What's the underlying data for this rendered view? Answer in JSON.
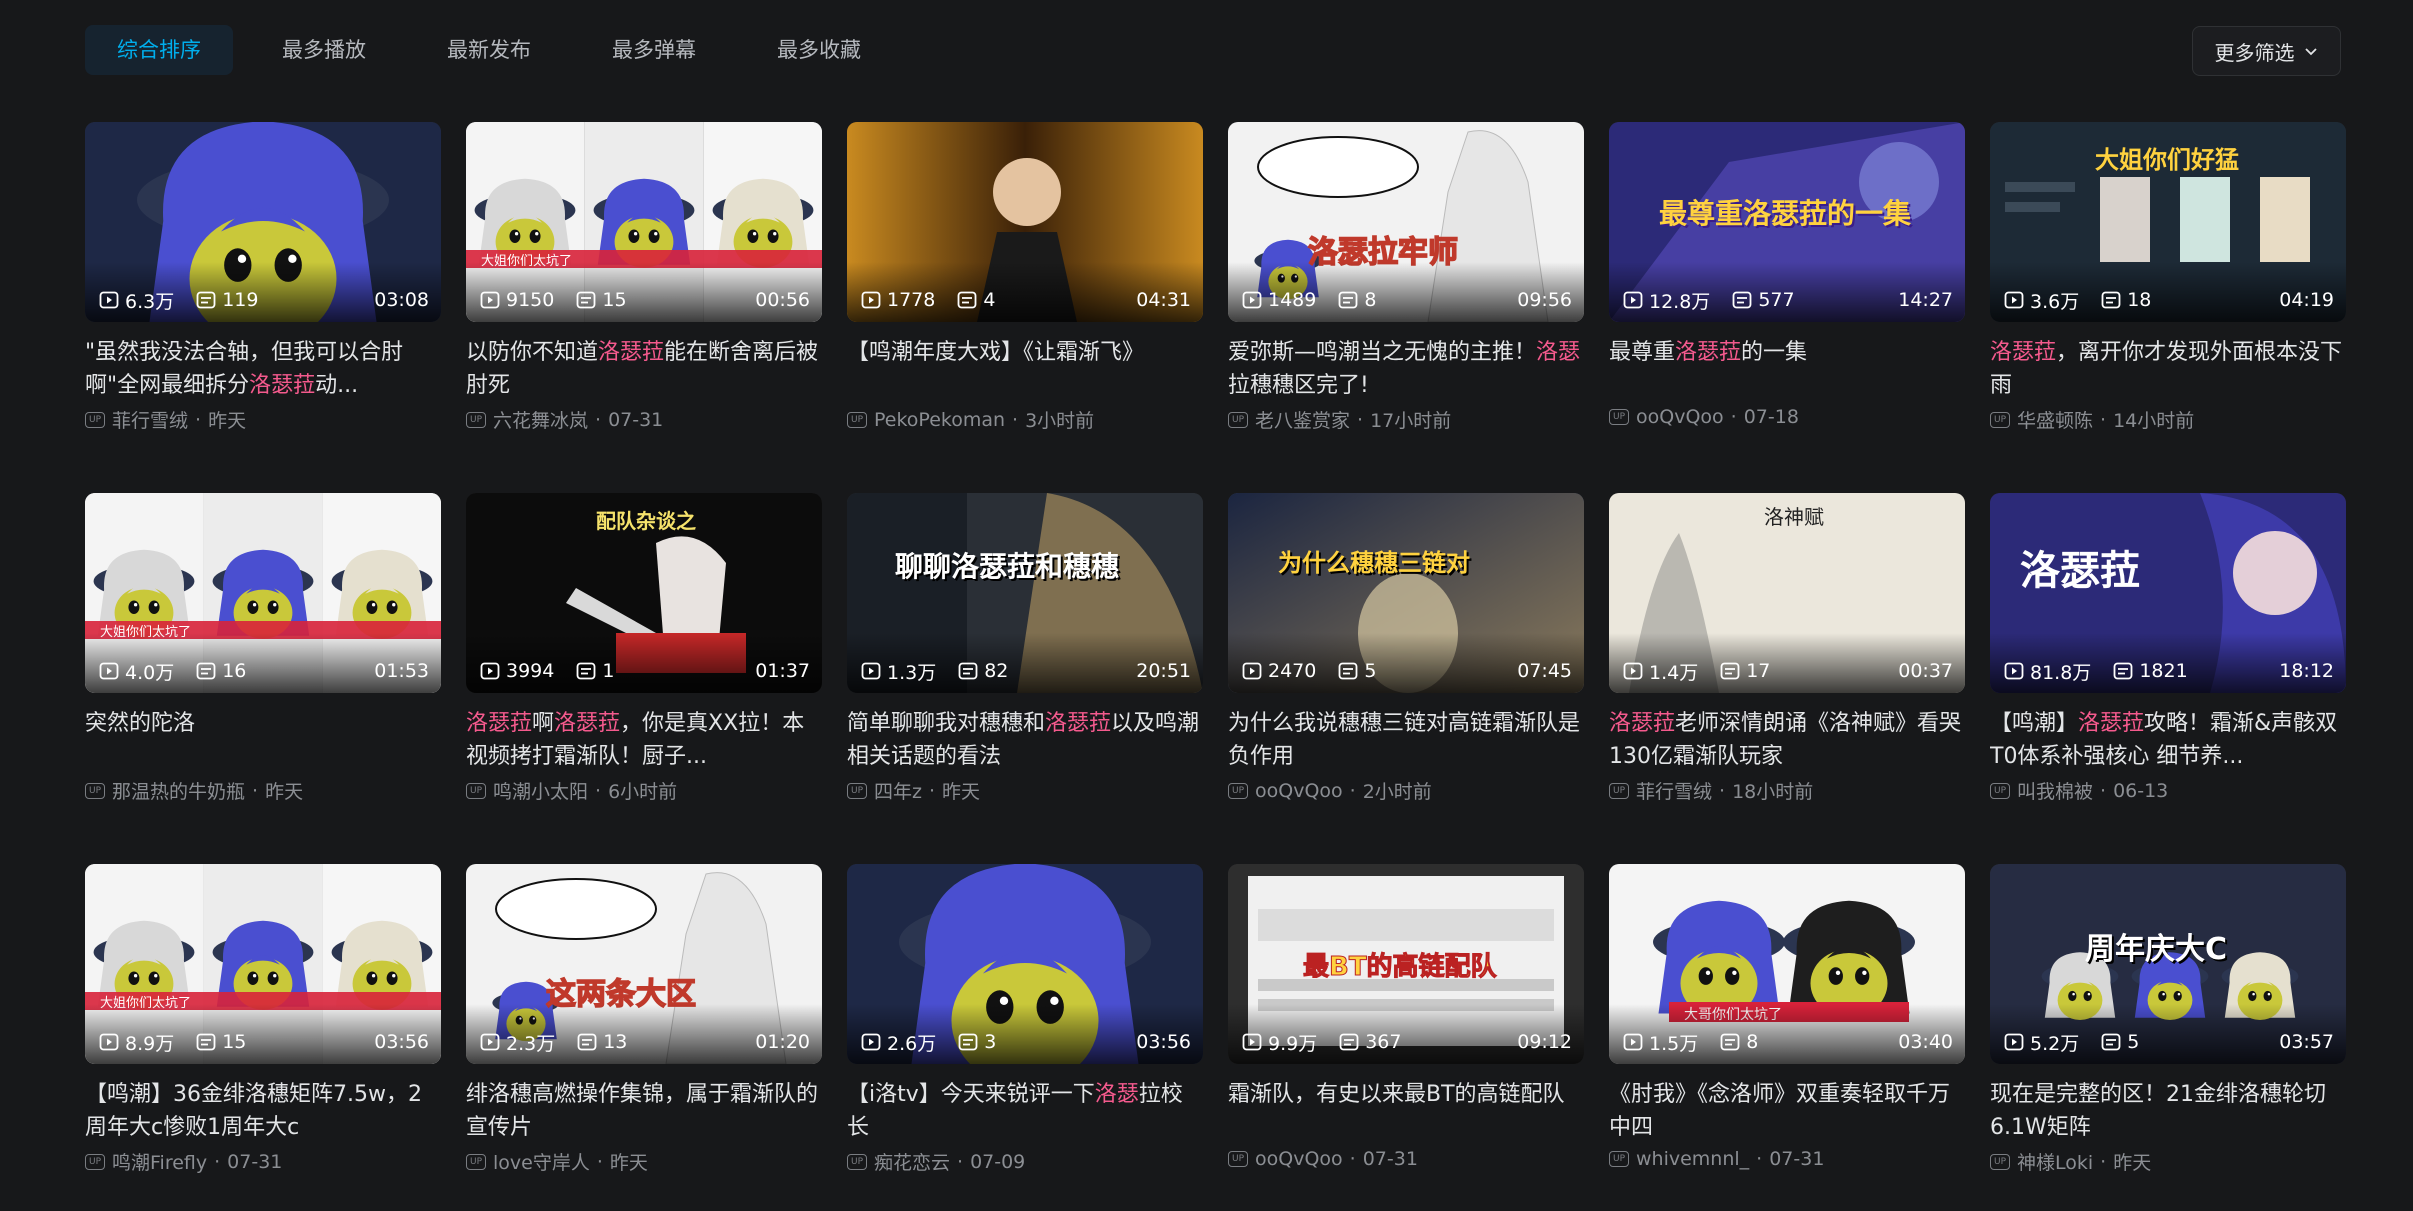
{
  "sort_tabs": [
    "综合排序",
    "最多播放",
    "最新发布",
    "最多弹幕",
    "最多收藏"
  ],
  "more_filter": "更多筛选",
  "colors": {
    "accent": "#00aeec",
    "highlight": "#f45a8d",
    "background": "#17181a"
  },
  "videos": [
    {
      "views": "6.3万",
      "danmaku": "119",
      "duration": "03:08",
      "title_parts": [
        {
          "t": "\"虽然我没法合轴，但我可以合肘啊\"全网最细拆分"
        },
        {
          "t": "洛瑟菈",
          "hl": true
        },
        {
          "t": "动..."
        }
      ],
      "author": "菲行雪绒",
      "date": "昨天",
      "art": "face",
      "bg": "#3a4f7a"
    },
    {
      "views": "9150",
      "danmaku": "15",
      "duration": "00:56",
      "title_parts": [
        {
          "t": "以防你不知道"
        },
        {
          "t": "洛瑟菈",
          "hl": true
        },
        {
          "t": "能在断舍离后被肘死"
        }
      ],
      "author": "六花舞冰岚",
      "date": "07-31",
      "art": "trio",
      "bg": "#dcdcdc",
      "caption": "大姐你们太坑了"
    },
    {
      "views": "1778",
      "danmaku": "4",
      "duration": "04:31",
      "title_parts": [
        {
          "t": "【鸣潮年度大戏】《让霜渐飞》"
        }
      ],
      "author": "PekoPekoman",
      "date": "3小时前",
      "art": "stage",
      "bg": "#7a4a16"
    },
    {
      "views": "1489",
      "danmaku": "8",
      "duration": "09:56",
      "title_parts": [
        {
          "t": "爱弥斯—鸣潮当之无愧的主推！"
        },
        {
          "t": "洛瑟",
          "hl": true
        },
        {
          "t": "拉穗穗区完了!"
        }
      ],
      "author": "老八鉴赏家",
      "date": "17小时前",
      "art": "comic",
      "bg": "#ededed",
      "caption": "洛瑟拉牢师"
    },
    {
      "views": "12.8万",
      "danmaku": "577",
      "duration": "14:27",
      "title_parts": [
        {
          "t": "最尊重"
        },
        {
          "t": "洛瑟菈",
          "hl": true
        },
        {
          "t": "的一集"
        }
      ],
      "author": "ooQvQoo",
      "date": "07-18",
      "art": "purple",
      "bg": "#3b3a8c",
      "caption": "最尊重洛瑟菈的一集"
    },
    {
      "views": "3.6万",
      "danmaku": "18",
      "duration": "04:19",
      "title_parts": [
        {
          "t": "洛瑟菈",
          "hl": true
        },
        {
          "t": "，离开你才发现外面根本没下雨"
        }
      ],
      "author": "华盛顿陈",
      "date": "14小时前",
      "art": "team",
      "bg": "#1f3040",
      "caption": "大姐你们好猛"
    },
    {
      "views": "4.0万",
      "danmaku": "16",
      "duration": "01:53",
      "title_parts": [
        {
          "t": "突然的陀洛"
        }
      ],
      "author": "那温热的牛奶瓶",
      "date": "昨天",
      "art": "trio",
      "bg": "#e8e8e8",
      "caption": "大姐你们太坑了"
    },
    {
      "views": "3994",
      "danmaku": "1",
      "duration": "01:37",
      "title_parts": [
        {
          "t": "洛瑟菈",
          "hl": true
        },
        {
          "t": "啊"
        },
        {
          "t": "洛瑟菈",
          "hl": true
        },
        {
          "t": "，你是真XX拉！本视频拷打霜渐队！厨子..."
        }
      ],
      "author": "鸣潮小太阳",
      "date": "6小时前",
      "art": "dark",
      "bg": "#101010",
      "caption": "配队杂谈之"
    },
    {
      "views": "1.3万",
      "danmaku": "82",
      "duration": "20:51",
      "title_parts": [
        {
          "t": "简单聊聊我对穗穗和"
        },
        {
          "t": "洛瑟菈",
          "hl": true
        },
        {
          "t": "以及鸣潮相关话题的看法"
        }
      ],
      "author": "四年z",
      "date": "昨天",
      "art": "talk",
      "bg": "#2a3038",
      "caption": "聊聊洛瑟菈和穗穗"
    },
    {
      "views": "2470",
      "danmaku": "5",
      "duration": "07:45",
      "title_parts": [
        {
          "t": "为什么我说穗穗三链对高链霜渐队是负作用"
        }
      ],
      "author": "ooQvQoo",
      "date": "2小时前",
      "art": "game",
      "bg": "#2c3a55",
      "caption": "为什么穗穗三链对"
    },
    {
      "views": "1.4万",
      "danmaku": "17",
      "duration": "00:37",
      "title_parts": [
        {
          "t": "洛瑟菈",
          "hl": true
        },
        {
          "t": "老师深情朗诵《洛神赋》看哭130亿霜渐队玩家"
        }
      ],
      "author": "菲行雪绒",
      "date": "18小时前",
      "art": "poem",
      "bg": "#e9e6dc",
      "caption": "洛神赋"
    },
    {
      "views": "81.8万",
      "danmaku": "1821",
      "duration": "18:12",
      "title_parts": [
        {
          "t": "【鸣潮】"
        },
        {
          "t": "洛瑟菈",
          "hl": true
        },
        {
          "t": "攻略！霜渐&声骸双T0体系补强核心 细节养..."
        }
      ],
      "author": "叫我棉被",
      "date": "06-13",
      "art": "guide",
      "bg": "#2d2a7a",
      "caption": "洛瑟菈"
    },
    {
      "views": "8.9万",
      "danmaku": "15",
      "duration": "03:56",
      "title_parts": [
        {
          "t": "【鸣潮】36金绯洛穗矩阵7.5w，2周年大c惨败1周年大c"
        }
      ],
      "author": "鸣潮Firefly",
      "date": "07-31",
      "art": "trio",
      "bg": "#e8e8e8",
      "caption": "大姐你们太坑了"
    },
    {
      "views": "2.3万",
      "danmaku": "13",
      "duration": "01:20",
      "title_parts": [
        {
          "t": "绯洛穗高燃操作集锦，属于霜渐队的宣传片"
        }
      ],
      "author": "love守岸人",
      "date": "昨天",
      "art": "comic",
      "bg": "#ededed",
      "caption": "这两条大区"
    },
    {
      "views": "2.6万",
      "danmaku": "3",
      "duration": "03:56",
      "title_parts": [
        {
          "t": "【i洛tv】今天来锐评一下"
        },
        {
          "t": "洛瑟",
          "hl": true
        },
        {
          "t": "拉校长"
        }
      ],
      "author": "痴花恋云",
      "date": "07-09",
      "art": "face",
      "bg": "#3a4f7a"
    },
    {
      "views": "9.9万",
      "danmaku": "367",
      "duration": "09:12",
      "title_parts": [
        {
          "t": "霜渐队，有史以来最BT的高链配队"
        }
      ],
      "author": "ooQvQoo",
      "date": "07-31",
      "art": "dialog",
      "bg": "#3a3a3a",
      "caption": "最BT的高链配队"
    },
    {
      "views": "1.5万",
      "danmaku": "8",
      "duration": "03:40",
      "title_parts": [
        {
          "t": "《肘我》《念洛师》双重奏轻取千万中四"
        }
      ],
      "author": "whivemnnl_",
      "date": "07-31",
      "art": "duo",
      "bg": "#f2f2f2",
      "caption": "大哥你们太坑了"
    },
    {
      "views": "5.2万",
      "danmaku": "5",
      "duration": "03:57",
      "title_parts": [
        {
          "t": "现在是完整的区！21金绯洛穗轮切6.1W矩阵"
        }
      ],
      "author": "神様Loki",
      "date": "昨天",
      "art": "anniv",
      "bg": "#2a2f45",
      "caption": "周年庆大C"
    }
  ]
}
